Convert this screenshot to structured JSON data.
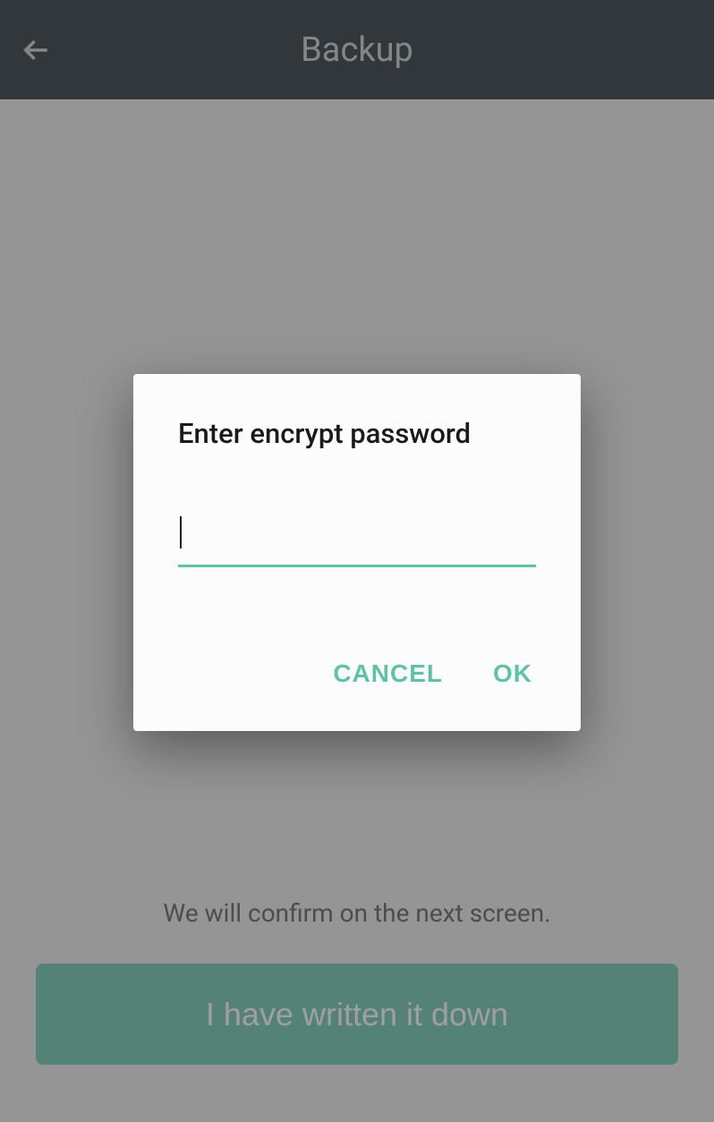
{
  "header": {
    "title": "Backup"
  },
  "content": {
    "confirm_text": "We will confirm on the next screen.",
    "primary_button_label": "I have written it down"
  },
  "dialog": {
    "title": "Enter encrypt password",
    "input_value": "",
    "cancel_label": "CANCEL",
    "ok_label": "OK"
  }
}
